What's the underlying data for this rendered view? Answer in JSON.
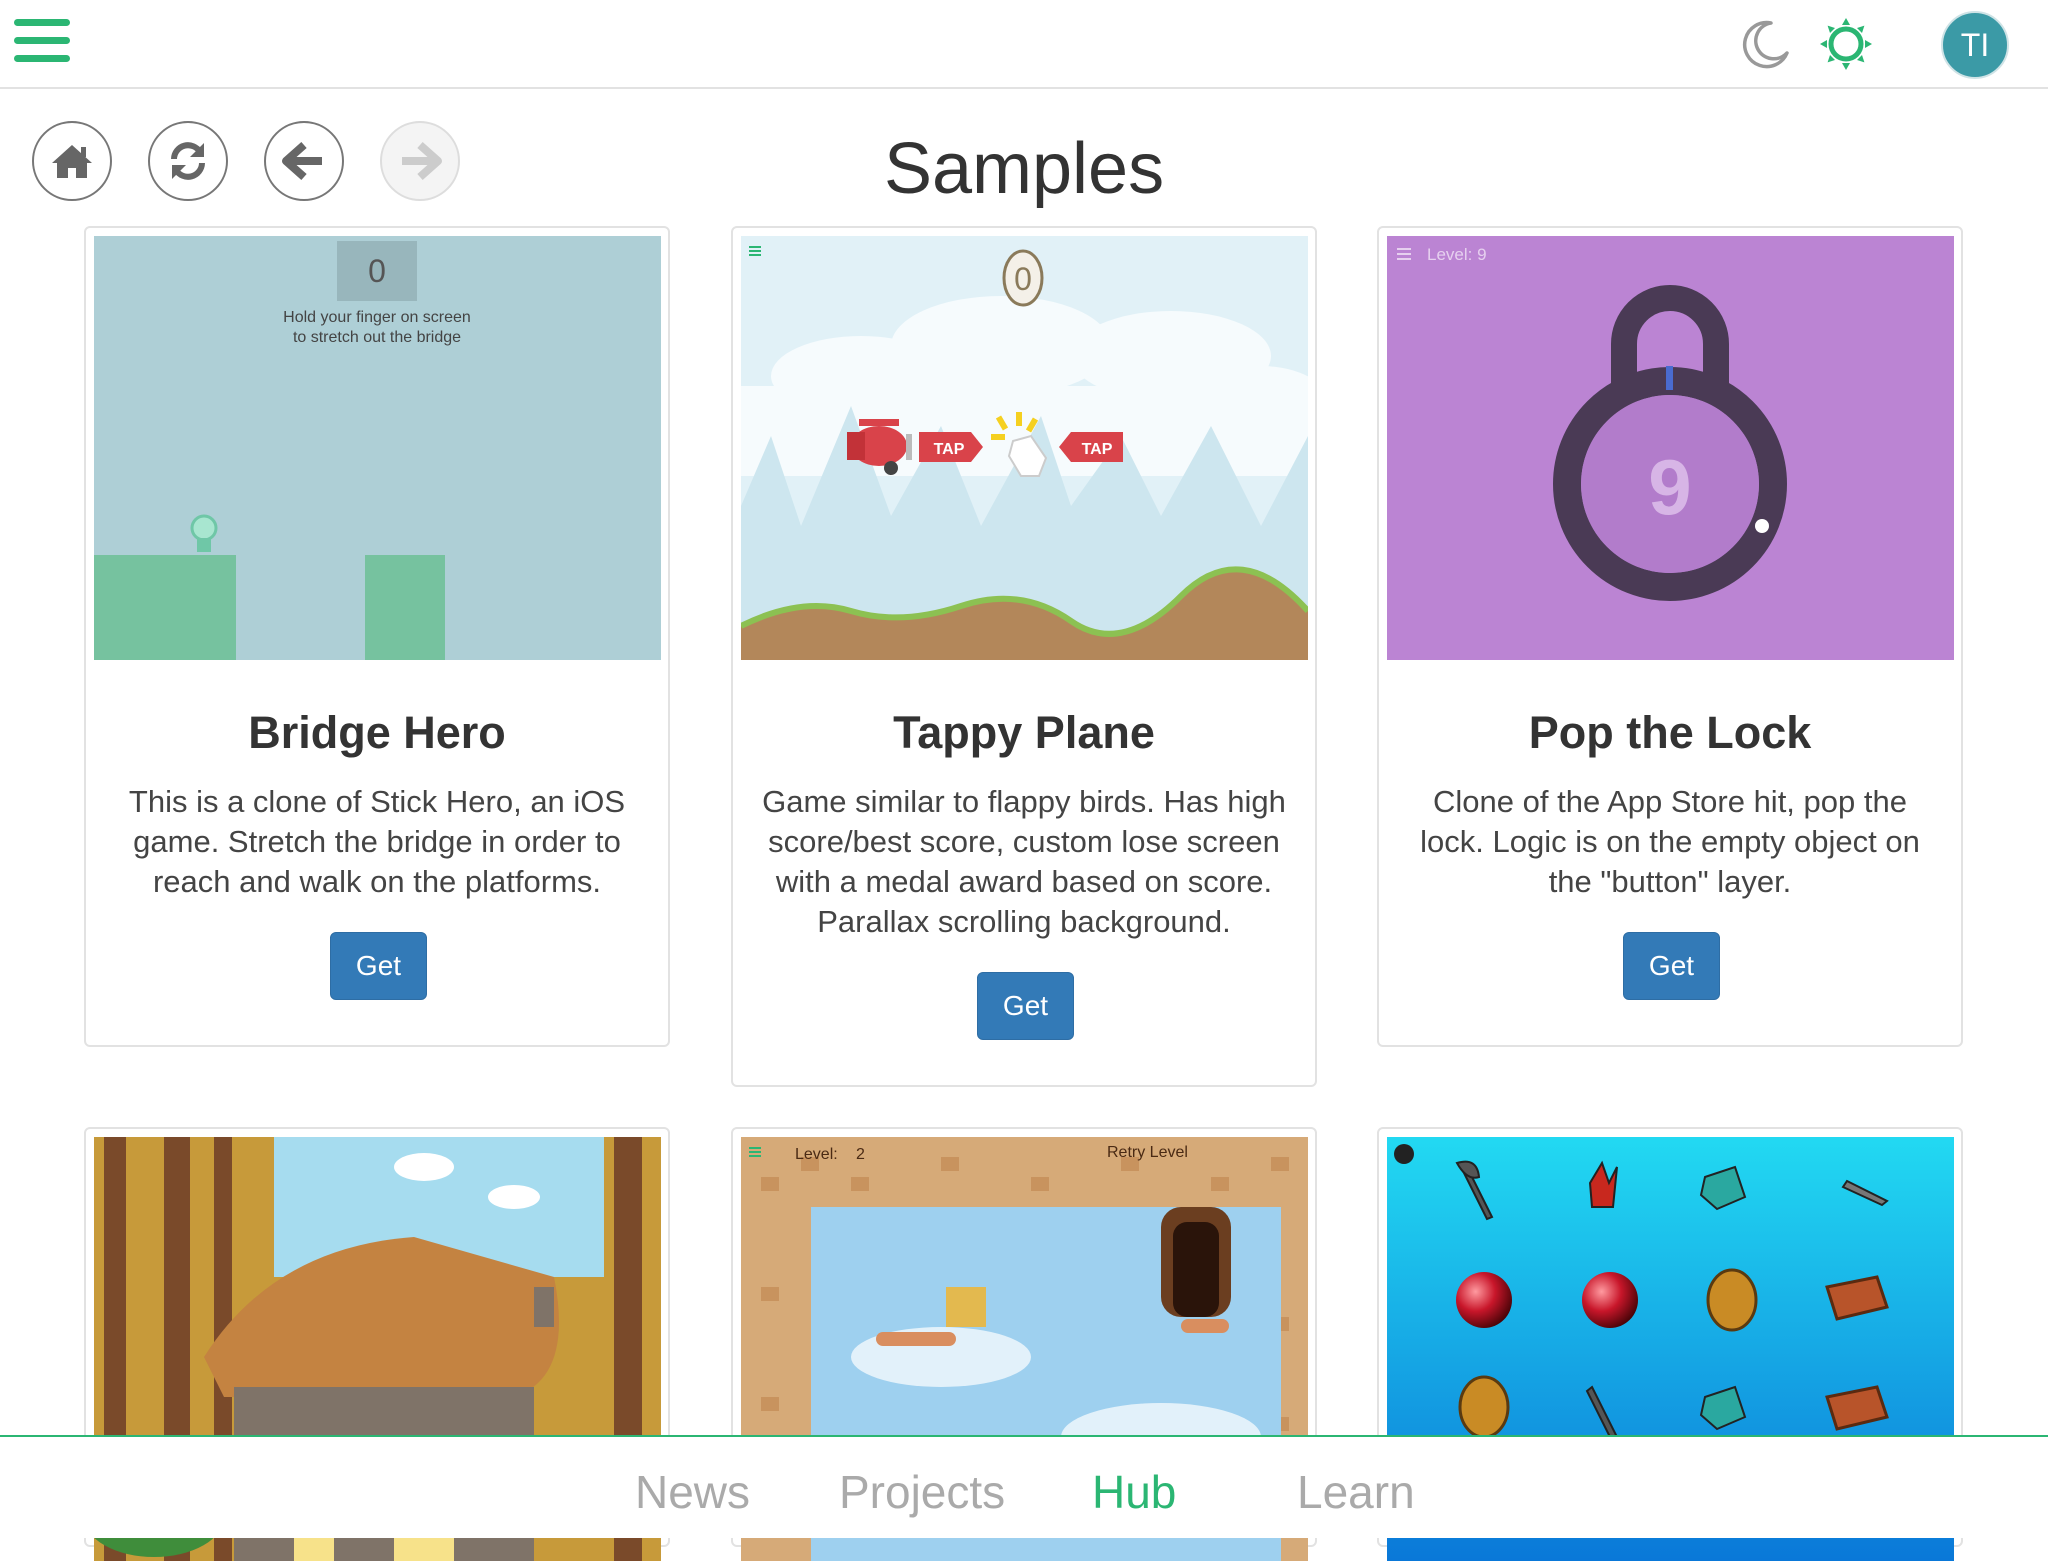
{
  "header": {
    "menu_icon": "hamburger-icon",
    "theme_dark_icon": "moon-icon",
    "theme_light_icon": "sun-icon",
    "avatar_initials": "TI",
    "accent_color": "#2bb673"
  },
  "nav": {
    "home_icon": "home-icon",
    "refresh_icon": "refresh-icon",
    "back_icon": "arrow-left-icon",
    "forward_icon": "arrow-right-icon"
  },
  "page": {
    "title": "Samples"
  },
  "cards": [
    {
      "title": "Bridge Hero",
      "description": "This is a clone of Stick Hero, an iOS game. Stretch the bridge in order to reach and walk on the platforms.",
      "button": "Get",
      "thumb": {
        "score": "0",
        "hint_line1": "Hold your finger on screen",
        "hint_line2": "to stretch out the bridge"
      }
    },
    {
      "title": "Tappy Plane",
      "description": "Game similar to flappy birds. Has high score/best score, custom lose screen with a medal award based on score. Parallax scrolling background.",
      "button": "Get",
      "thumb": {
        "score": "0",
        "tap1": "TAP",
        "tap2": "TAP"
      }
    },
    {
      "title": "Pop the Lock",
      "description": "Clone of the App Store hit, pop the lock. Logic is on the empty object on the \"button\" layer.",
      "button": "Get",
      "thumb": {
        "level_label": "Level: 9",
        "number": "9"
      }
    },
    {
      "title": "",
      "thumb": {}
    },
    {
      "title": "",
      "thumb": {
        "level_label": "Level:",
        "level_value": "2",
        "retry": "Retry Level"
      }
    },
    {
      "title": "",
      "thumb": {}
    }
  ],
  "bottom_tabs": [
    {
      "label": "News",
      "active": false
    },
    {
      "label": "Projects",
      "active": false
    },
    {
      "label": "Hub",
      "active": true
    },
    {
      "label": "Learn",
      "active": false
    }
  ]
}
